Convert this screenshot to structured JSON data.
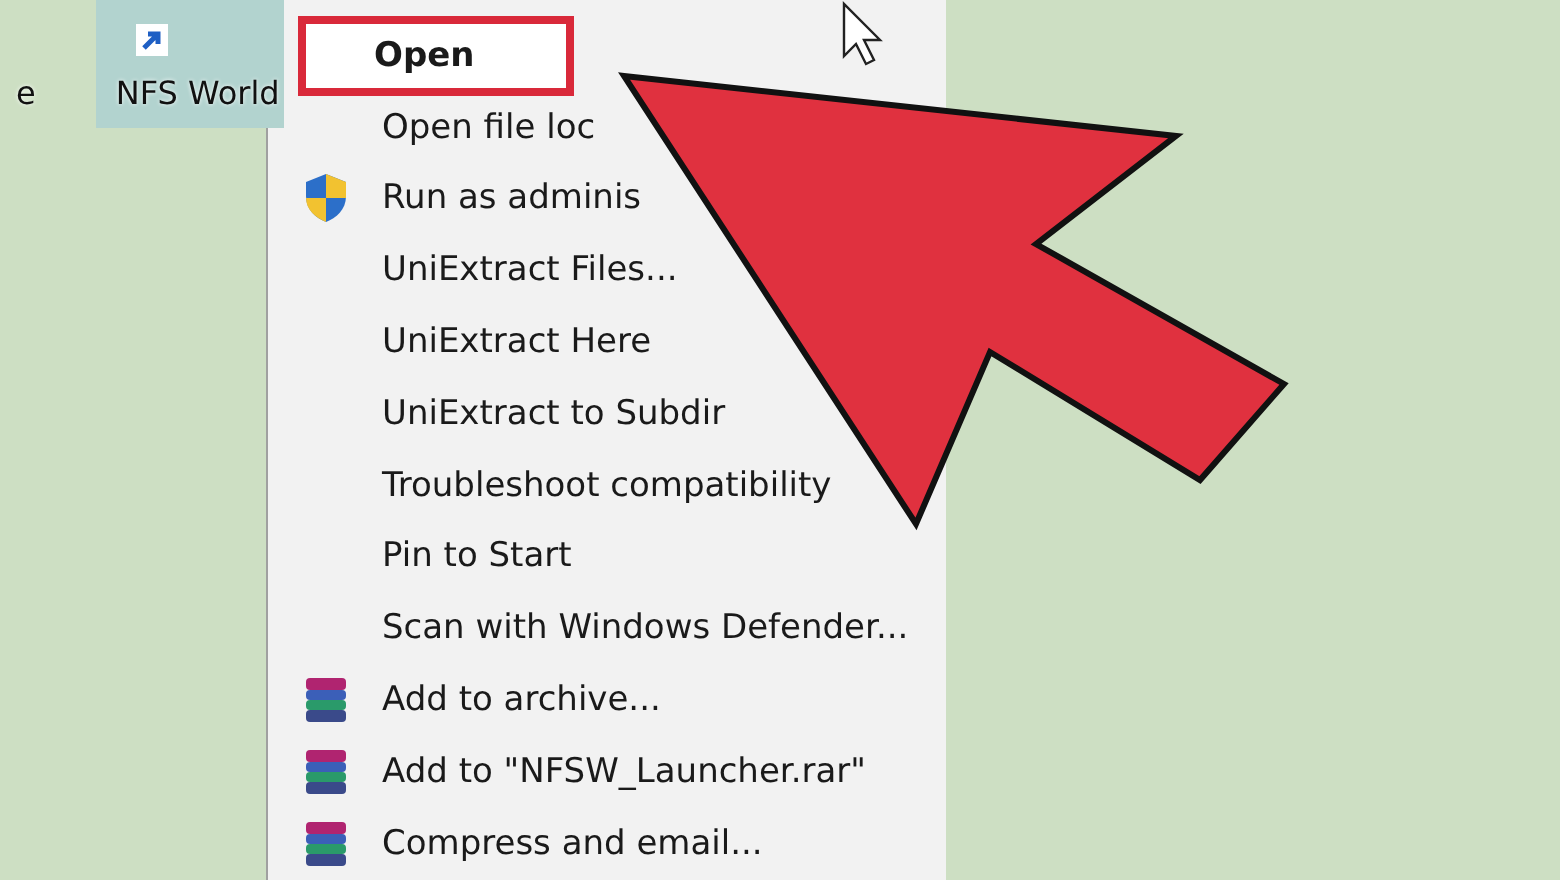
{
  "desktop": {
    "icons": [
      {
        "label": "e",
        "selected": false
      },
      {
        "label": "NFS World",
        "selected": true
      }
    ]
  },
  "context_menu": {
    "items": [
      {
        "label": "Open",
        "kind": "plain",
        "default": true,
        "highlighted": true
      },
      {
        "label": "Open file loc",
        "kind": "plain",
        "default": false,
        "highlighted": false
      },
      {
        "label": "Run as adminis",
        "kind": "shield",
        "default": false,
        "highlighted": false
      },
      {
        "label": "UniExtract Files...",
        "kind": "plain",
        "default": false,
        "highlighted": false
      },
      {
        "label": "UniExtract Here",
        "kind": "plain",
        "default": false,
        "highlighted": false
      },
      {
        "label": "UniExtract to Subdir",
        "kind": "plain",
        "default": false,
        "highlighted": false
      },
      {
        "label": "Troubleshoot compatibility",
        "kind": "plain",
        "default": false,
        "highlighted": false
      },
      {
        "label": "Pin to Start",
        "kind": "plain",
        "default": false,
        "highlighted": false
      },
      {
        "label": "Scan with Windows Defender...",
        "kind": "plain",
        "default": false,
        "highlighted": false
      },
      {
        "label": "Add to archive...",
        "kind": "archive",
        "default": false,
        "highlighted": false
      },
      {
        "label": "Add to \"NFSW_Launcher.rar\"",
        "kind": "archive",
        "default": false,
        "highlighted": false
      },
      {
        "label": "Compress and email...",
        "kind": "archive",
        "default": false,
        "highlighted": false
      }
    ]
  }
}
